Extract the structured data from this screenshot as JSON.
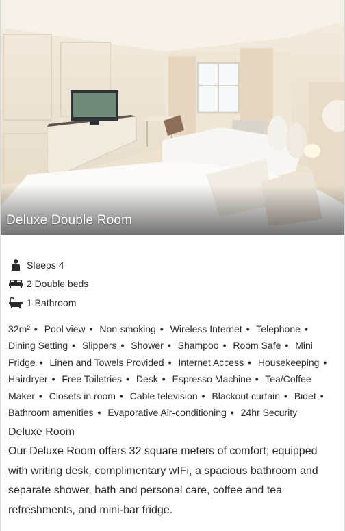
{
  "room": {
    "title": "Deluxe Double Room",
    "sleeps": "Sleeps 4",
    "beds": "2 Double beds",
    "bathroom": "1 Bathroom"
  },
  "amenities": [
    "32m²",
    "Pool view",
    "Non-smoking",
    "Wireless Internet",
    "Telephone",
    "Dining Setting",
    "Slippers",
    "Shower",
    "Shampoo",
    "Room Safe",
    "Mini Fridge",
    "Linen and Towels Provided",
    "Internet Access",
    "Housekeeping",
    "Hairdryer",
    "Free Toiletries",
    "Desk",
    "Espresso Machine",
    "Tea/Coffee Maker",
    "Closets in room",
    "Cable television",
    "Blackout curtain",
    "Bidet",
    "Bathroom amenities",
    "Evaporative Air-conditioning",
    "24hr Security"
  ],
  "description": {
    "title": "Deluxe Room",
    "body": "Our Deluxe Room offers 32 square meters of comfort; equipped with writing desk, complimentary wIFi, a spacious bathroom and separate shower, bath and personal care, coffee and tea refreshments, and mini-bar fridge."
  },
  "icons": {
    "person": "person-icon",
    "bed": "bed-icon",
    "bath": "bath-icon",
    "next": "chevron-right-icon"
  },
  "colors": {
    "text": "#2b2b2b",
    "overlay_text": "#ffffff"
  }
}
